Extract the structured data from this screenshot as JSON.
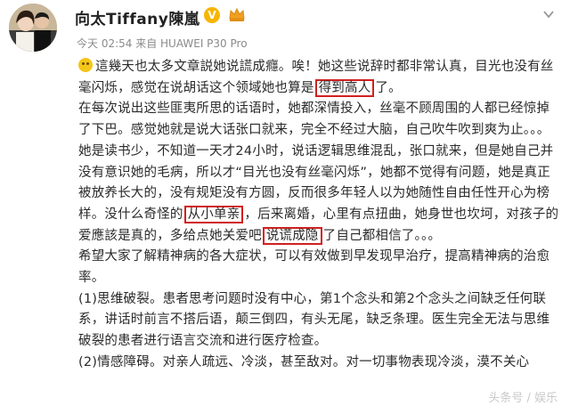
{
  "header": {
    "name": "向太Tiffany陳嵐",
    "meta": "今天 02:54 来自 HUAWEI P30 Pro",
    "verified_badge": "V"
  },
  "post": {
    "p1_a": "這幾天也太多文章説她说謊成癮。唉！她这些说辞时都非常认真，目光也没有丝毫闪烁，感觉在说胡话这个领域她也算是",
    "p1_hl": "得到高人",
    "p1_b": "了。",
    "p2_a": "在每次说出这些匪夷所思的话语时，她都深情投入，丝毫不顾周围的人都已经惊掉了下巴。感觉她就是说大话张口就来，完全不经过大脑，自己吹牛吹到爽为止。。。她是读书少，不知道一天才24小时，说话逻辑思维混乱，张口就来，但是她自己并没有意识她的毛病，所以才“目光也没有丝毫闪烁”，她都不觉得有问题，她是真正被放养长大的，没有规矩没有方圆，反而很多年轻人以为她随性自由任性开心为榜样。没什么奇怪的",
    "p2_hl1": "从小单亲",
    "p2_b": "，后来离婚，心里有点扭曲，她身世也坎坷，对孩子的爱應該是真的，多给点她关爱吧",
    "p2_hl2": "说谎成隐",
    "p2_c": "了自己都相信了。。。",
    "p3": "希望大家了解精神病的各大症状，可以有效做到早发现早治疗，提高精神病的治愈率。",
    "p4": "(1)思维破裂。患者思考问题时没有中心，第1个念头和第2个念头之间缺乏任何联系，讲话时前言不搭后语，颠三倒四，有头无尾，缺乏条理。医生完全无法与思维破裂的患者进行语言交流和进行医疗检查。",
    "p5": "(2)情感障碍。对亲人疏远、冷淡，甚至敌对。对一切事物表现冷淡，漠不关心"
  },
  "watermark": "头条号 / 娱乐"
}
